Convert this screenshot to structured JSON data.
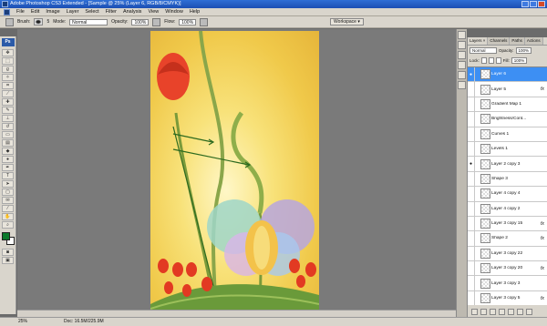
{
  "titlebar": {
    "title": "Adobe Photoshop CS3 Extended - [Sample @ 25% (Layer 6, RGB/8/CMYK)]"
  },
  "menu": [
    "File",
    "Edit",
    "Image",
    "Layer",
    "Select",
    "Filter",
    "Analysis",
    "View",
    "Window",
    "Help"
  ],
  "options": {
    "brush_label": "Brush:",
    "brush_size": "5",
    "mode_label": "Mode:",
    "mode_value": "Normal",
    "opacity_label": "Opacity:",
    "opacity_value": "100%",
    "flow_label": "Flow:",
    "flow_value": "100%",
    "workspace_label": "Workspace ▾"
  },
  "toolbox": {
    "badge": "Ps",
    "fg_color": "#0b7a2b",
    "bg_color": "#ffffff"
  },
  "layers_panel": {
    "tabs": [
      "Layers ×",
      "Channels",
      "Paths",
      "Actions"
    ],
    "blend_mode": "Normal",
    "opacity_label": "Opacity:",
    "opacity_value": "100%",
    "lock_label": "Lock:",
    "fill_label": "Fill:",
    "fill_value": "100%",
    "rows": [
      {
        "name": "Layer 6",
        "selected": true,
        "eye": "●",
        "fx": ""
      },
      {
        "name": "Layer 5",
        "selected": false,
        "eye": "",
        "fx": "fx"
      },
      {
        "name": "Gradient Map 1",
        "selected": false,
        "eye": "",
        "fx": ""
      },
      {
        "name": "Brightness/Cont...",
        "selected": false,
        "eye": "",
        "fx": ""
      },
      {
        "name": "Curves 1",
        "selected": false,
        "eye": "",
        "fx": ""
      },
      {
        "name": "Levels 1",
        "selected": false,
        "eye": "",
        "fx": ""
      },
      {
        "name": "Layer 2 copy 3",
        "selected": false,
        "eye": "●",
        "fx": ""
      },
      {
        "name": "Shape 3",
        "selected": false,
        "eye": "",
        "fx": ""
      },
      {
        "name": "Layer 4 copy 4",
        "selected": false,
        "eye": "",
        "fx": ""
      },
      {
        "name": "Layer 4 copy 2",
        "selected": false,
        "eye": "",
        "fx": ""
      },
      {
        "name": "Layer 3 copy 15",
        "selected": false,
        "eye": "",
        "fx": "fx"
      },
      {
        "name": "Shape 2",
        "selected": false,
        "eye": "",
        "fx": "fx"
      },
      {
        "name": "Layer 3 copy 22",
        "selected": false,
        "eye": "",
        "fx": ""
      },
      {
        "name": "Layer 3 copy 20",
        "selected": false,
        "eye": "",
        "fx": "fx"
      },
      {
        "name": "Layer 3 copy 3",
        "selected": false,
        "eye": "",
        "fx": ""
      },
      {
        "name": "Layer 3 copy 5",
        "selected": false,
        "eye": "",
        "fx": "fx"
      },
      {
        "name": "Layer 3 copy 23",
        "selected": false,
        "eye": "",
        "fx": "fx"
      }
    ]
  },
  "status": {
    "zoom": "25%",
    "doc": "Doc: 16.5M/225.9M"
  }
}
